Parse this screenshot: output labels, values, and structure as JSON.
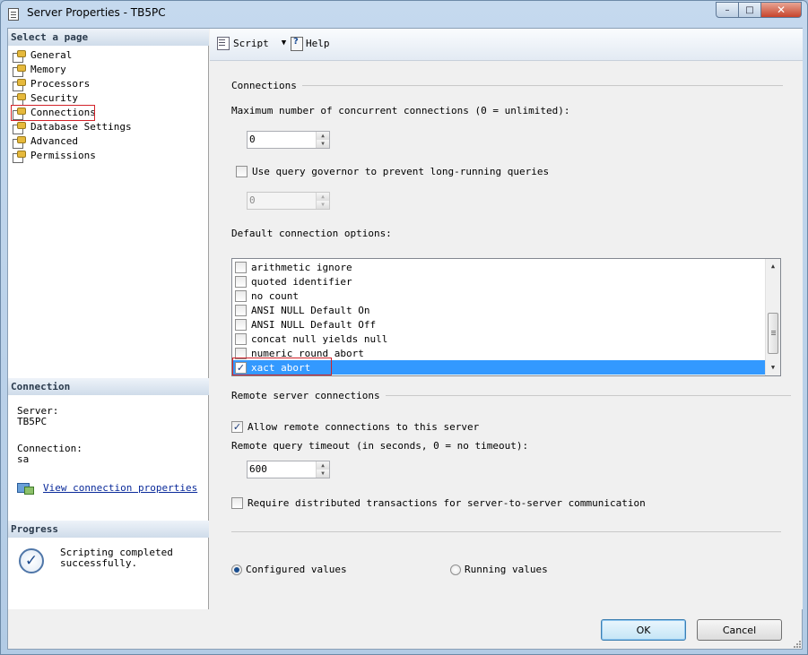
{
  "window": {
    "title": "Server Properties - TB5PC",
    "minimize": "–",
    "maximize": "□",
    "close": "✕"
  },
  "select_page": {
    "header": "Select a page",
    "items": [
      {
        "label": "General",
        "icon": "page-wrench-icon"
      },
      {
        "label": "Memory",
        "icon": "page-wrench-icon"
      },
      {
        "label": "Processors",
        "icon": "page-wrench-icon"
      },
      {
        "label": "Security",
        "icon": "page-wrench-icon"
      },
      {
        "label": "Connections",
        "icon": "page-wrench-icon",
        "selected": true
      },
      {
        "label": "Database Settings",
        "icon": "page-wrench-icon"
      },
      {
        "label": "Advanced",
        "icon": "page-wrench-icon"
      },
      {
        "label": "Permissions",
        "icon": "page-wrench-icon"
      }
    ]
  },
  "connection": {
    "header": "Connection",
    "server_label": "Server:",
    "server_value": "TB5PC",
    "connection_label": "Connection:",
    "connection_value": "sa",
    "view_link": "View connection properties"
  },
  "progress": {
    "header": "Progress",
    "line1": "Scripting completed",
    "line2": "successfully."
  },
  "toolbar": {
    "script_label": "Script",
    "dropdown": "▼",
    "help_label": "Help"
  },
  "connections_section": {
    "group_label": "Connections",
    "max_conn_label": "Maximum number of concurrent connections (0 = unlimited):",
    "max_conn_value": "0",
    "query_governor_label": "Use query governor to prevent long-running queries",
    "query_governor_checked": false,
    "query_governor_value": "0",
    "default_options_label": "Default connection options:",
    "options": [
      {
        "label": "arithmetic ignore",
        "checked": false
      },
      {
        "label": "quoted identifier",
        "checked": false
      },
      {
        "label": "no count",
        "checked": false
      },
      {
        "label": "ANSI NULL Default On",
        "checked": false
      },
      {
        "label": "ANSI NULL Default Off",
        "checked": false
      },
      {
        "label": "concat null yields null",
        "checked": false
      },
      {
        "label": "numeric round abort",
        "checked": false
      },
      {
        "label": "xact abort",
        "checked": true,
        "selected": true
      }
    ],
    "scroll_up": "▲",
    "scroll_down": "▼"
  },
  "remote_section": {
    "group_label": "Remote server connections",
    "allow_remote_label": "Allow remote connections to this server",
    "allow_remote_checked": true,
    "timeout_label": "Remote query timeout (in seconds, 0 = no timeout):",
    "timeout_value": "600",
    "require_dist_label": "Require distributed transactions for server-to-server communication",
    "require_dist_checked": false
  },
  "values_mode": {
    "configured_label": "Configured values",
    "running_label": "Running values",
    "selected": "configured"
  },
  "buttons": {
    "ok": "OK",
    "cancel": "Cancel"
  },
  "check_glyph": "✓",
  "spin_up": "▲",
  "spin_down": "▼"
}
